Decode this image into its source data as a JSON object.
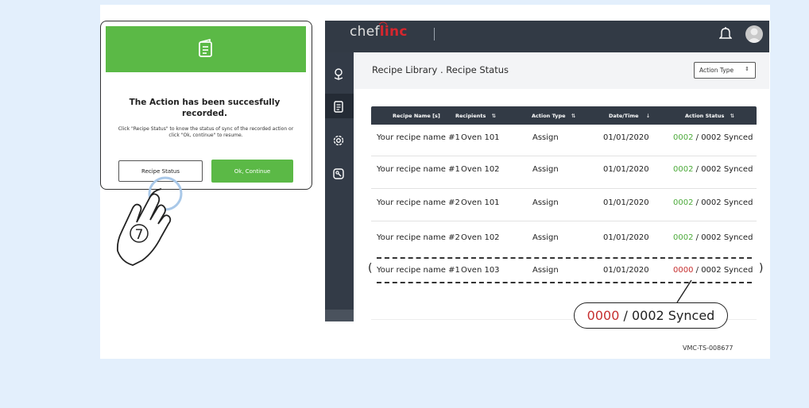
{
  "dialog": {
    "title": "The Action has been succesfully recorded.",
    "message": "Click \"Recipe Status\" to know the status of sync of the recorded action or click \"Ok, continue\" to resume.",
    "recipe_status_label": "Recipe Status",
    "ok_label": "Ok, Continue",
    "step_number": "7"
  },
  "app": {
    "logo_plain": "chef",
    "logo_accent": "linc",
    "breadcrumb": "Recipe Library . Recipe Status",
    "action_type_select": "Action Type"
  },
  "table": {
    "headers": [
      "Recipe Name [s]",
      "Recipients",
      "Action Type",
      "Date/Time",
      "Action Status"
    ],
    "header_sort": [
      "",
      "⇅",
      "⇅",
      "↓",
      "⇅"
    ],
    "rows": [
      {
        "name": "Your recipe name #1",
        "recipient": "Oven 101",
        "action": "Assign",
        "date": "01/01/2020",
        "synced": "0002",
        "total": "/ 0002 Synced"
      },
      {
        "name": "Your recipe name #1",
        "recipient": "Oven 102",
        "action": "Assign",
        "date": "01/01/2020",
        "synced": "0002",
        "total": "/ 0002 Synced"
      },
      {
        "name": "Your recipe name #2",
        "recipient": "Oven 101",
        "action": "Assign",
        "date": "01/01/2020",
        "synced": "0002",
        "total": "/ 0002 Synced"
      },
      {
        "name": "Your recipe name #2",
        "recipient": "Oven 102",
        "action": "Assign",
        "date": "01/01/2020",
        "synced": "0002",
        "total": "/ 0002 Synced"
      },
      {
        "name": "Your recipe name #1",
        "recipient": "Oven 103",
        "action": "Assign",
        "date": "01/01/2020",
        "synced": "0000",
        "total": "/ 0002 Synced"
      }
    ]
  },
  "callout": {
    "synced": "0000",
    "total": "/ 0002 Synced"
  },
  "doc_id": "VMC-TS-008677",
  "colors": {
    "green": "#5bb946",
    "red": "#c62f2f",
    "dark": "#323a45",
    "background": "#e3effc"
  },
  "icons": [
    "document-icon",
    "bell-icon",
    "avatar",
    "location-icon",
    "recipe-icon",
    "gear-icon",
    "tag-icon",
    "hand-pointer-icon"
  ]
}
